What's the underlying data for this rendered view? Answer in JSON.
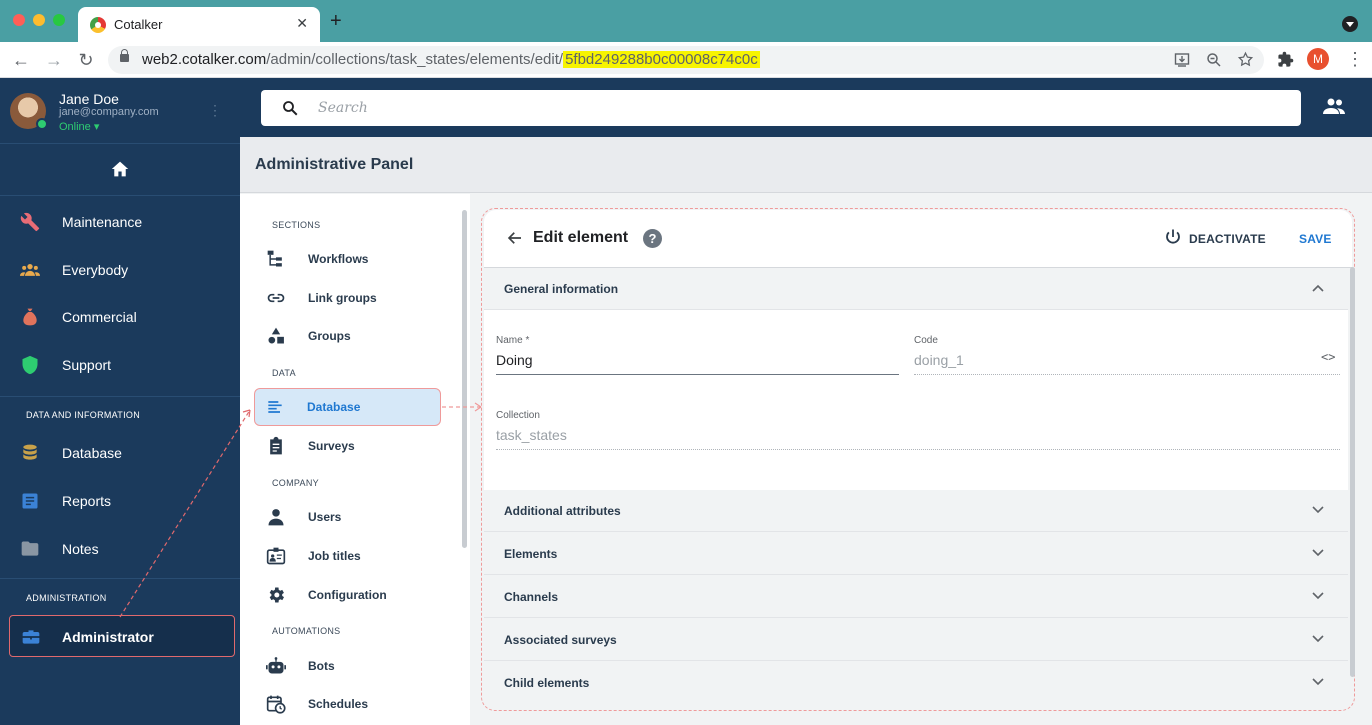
{
  "browser": {
    "tab_title": "Cotalker",
    "close_glyph": "✕",
    "new_tab_glyph": "+",
    "url_host": "web2.cotalker.com",
    "url_path": "/admin/collections/task_states/elements/edit/",
    "url_highlight": "5fbd249288b0c00008c74c0c",
    "profile_initial": "M",
    "traffic_colors": [
      "#ff5f57",
      "#febc2e",
      "#28c840"
    ]
  },
  "user": {
    "name": "Jane Doe",
    "email": "jane@company.com",
    "status": "Online ▾"
  },
  "sidebar": {
    "items": [
      {
        "label": "Maintenance",
        "icon": "wrench-icon",
        "color": "#e86c76"
      },
      {
        "label": "Everybody",
        "icon": "group-icon",
        "color": "#e8a94d"
      },
      {
        "label": "Commercial",
        "icon": "money-bag-icon",
        "color": "#e0735c"
      },
      {
        "label": "Support",
        "icon": "shield-icon",
        "color": "#2ecc71"
      }
    ],
    "data_section": "DATA AND INFORMATION",
    "data_items": [
      {
        "label": "Database",
        "icon": "database-icon",
        "color": "#c9a24a"
      },
      {
        "label": "Reports",
        "icon": "report-icon",
        "color": "#3b82d6"
      },
      {
        "label": "Notes",
        "icon": "folder-icon",
        "color": "#8a96a3"
      }
    ],
    "admin_section": "ADMINISTRATION",
    "admin_item": {
      "label": "Administrator",
      "icon": "toolbox-icon",
      "color": "#3b82d6"
    }
  },
  "header": {
    "search_placeholder": "Search"
  },
  "panel": {
    "title": "Administrative Panel"
  },
  "sections": {
    "sections_head": "SECTIONS",
    "sections_items": [
      "Workflows",
      "Link groups",
      "Groups"
    ],
    "data_head": "DATA",
    "data_items": [
      "Database",
      "Surveys"
    ],
    "company_head": "COMPANY",
    "company_items": [
      "Users",
      "Job titles",
      "Configuration"
    ],
    "automations_head": "AUTOMATIONS",
    "automations_items": [
      "Bots",
      "Schedules"
    ]
  },
  "edit": {
    "title": "Edit element",
    "help": "?",
    "deactivate_label": "DEACTIVATE",
    "save_label": "SAVE",
    "general_info": "General information",
    "name_label": "Name *",
    "name_value": "Doing",
    "code_label": "Code",
    "code_value": "doing_1",
    "code_glyph": "<>",
    "collection_label": "Collection",
    "collection_value": "task_states",
    "accordions": [
      "Additional attributes",
      "Elements",
      "Channels",
      "Associated surveys",
      "Child elements"
    ]
  }
}
